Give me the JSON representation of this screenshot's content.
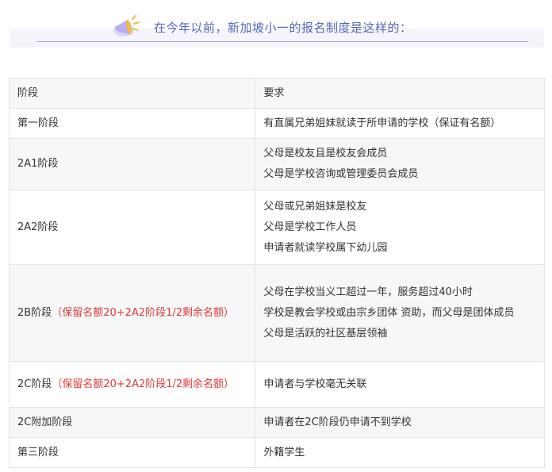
{
  "header": {
    "title": "在今年以前，新加坡小一的报名制度是这样的：",
    "icon": "megaphone-icon"
  },
  "table": {
    "headers": [
      "阶段",
      "要求"
    ],
    "rows": [
      {
        "stage": "第一阶段",
        "stage_note": "",
        "requirements": [
          "有直属兄弟姐妹就读于所申请的学校（保证有名额）"
        ]
      },
      {
        "stage": "2A1阶段",
        "stage_note": "",
        "requirements": [
          "父母是校友且是校友会成员",
          "父母是学校咨询或管理委员会成员"
        ]
      },
      {
        "stage": "2A2阶段",
        "stage_note": "",
        "requirements": [
          "父母或兄弟姐妹是校友",
          "父母是学校工作人员",
          "申请者就读学校属下幼儿园"
        ]
      },
      {
        "stage": "2B阶段",
        "stage_note": "（保留名额20+2A2阶段1/2剩余名额）",
        "requirements": [
          "父母在学校当义工超过一年，服务超过40小时",
          "学校是教会学校或由宗乡团体 资助，而父母是团体成员",
          "父母是活跃的社区基层领袖"
        ]
      },
      {
        "stage": "2C阶段",
        "stage_note": "（保留名额20+2A2阶段1/2剩余名额）",
        "requirements": [
          "申请者与学校毫无关联"
        ]
      },
      {
        "stage": "2C附加阶段",
        "stage_note": "",
        "requirements": [
          "申请者在2C阶段仍申请不到学校"
        ]
      },
      {
        "stage": "第三阶段",
        "stage_note": "",
        "requirements": [
          "外籍学生"
        ]
      }
    ]
  },
  "colors": {
    "title": "#5566bb",
    "note": "#e53935",
    "row_alt": "#f6f7f9",
    "border": "#e3e3e3"
  }
}
